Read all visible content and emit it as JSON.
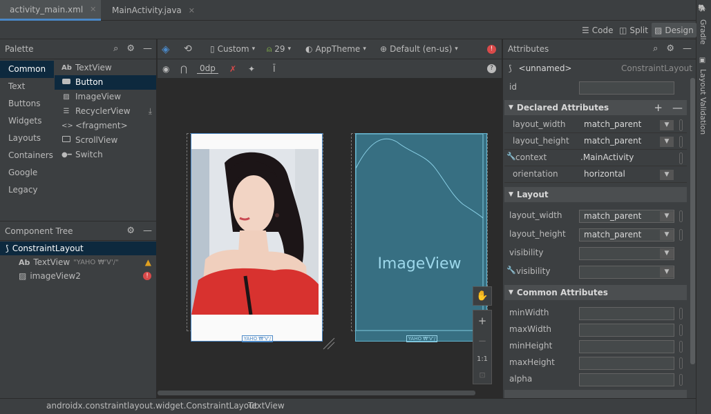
{
  "tabs": [
    {
      "label": "activity_main.xml",
      "active": true
    },
    {
      "label": "MainActivity.java",
      "active": false
    }
  ],
  "right_strip": {
    "gradle": "Gradle",
    "layout_validation": "Layout Validation"
  },
  "view_modes": {
    "code": "Code",
    "split": "Split",
    "design": "Design"
  },
  "palette": {
    "title": "Palette",
    "categories": [
      "Common",
      "Text",
      "Buttons",
      "Widgets",
      "Layouts",
      "Containers",
      "Google",
      "Legacy"
    ],
    "items": [
      {
        "icon": "Ab",
        "label": "TextView"
      },
      {
        "icon": "btn",
        "label": "Button"
      },
      {
        "icon": "img",
        "label": "ImageView"
      },
      {
        "icon": "list",
        "label": "RecyclerView"
      },
      {
        "icon": "<>",
        "label": "<fragment>"
      },
      {
        "icon": "scroll",
        "label": "ScrollView"
      },
      {
        "icon": "sw",
        "label": "Switch"
      }
    ]
  },
  "component_tree": {
    "title": "Component Tree",
    "root": "ConstraintLayout",
    "children": [
      {
        "icon": "Ab",
        "label": "TextView",
        "detail": "\"YAHO ₩'V'/\"",
        "status": "warning"
      },
      {
        "icon": "img",
        "label": "imageView2",
        "detail": "",
        "status": "error"
      }
    ]
  },
  "canvas_toolbar": {
    "device": "Custom",
    "api": "29",
    "theme": "AppTheme",
    "locale": "Default (en-us)",
    "margin": "0dp"
  },
  "canvas": {
    "design_caption": "YAHO ₩'V'/",
    "blueprint_label": "ImageView",
    "blueprint_caption": "YAHO ₩'V'/",
    "zoom_fit": "1:1"
  },
  "attributes": {
    "title": "Attributes",
    "component": "<unnamed>",
    "component_type": "ConstraintLayout",
    "id_label": "id",
    "id_value": "",
    "declared": {
      "title": "Declared Attributes",
      "rows": [
        {
          "label": "layout_width",
          "value": "match_parent"
        },
        {
          "label": "layout_height",
          "value": "match_parent"
        },
        {
          "label": "context",
          "value": ".MainActivity"
        },
        {
          "label": "orientation",
          "value": "horizontal"
        }
      ]
    },
    "layout": {
      "title": "Layout",
      "rows": [
        {
          "label": "layout_width",
          "value": "match_parent"
        },
        {
          "label": "layout_height",
          "value": "match_parent"
        },
        {
          "label": "visibility",
          "value": ""
        },
        {
          "label": "visibility",
          "value": ""
        }
      ]
    },
    "common": {
      "title": "Common Attributes",
      "rows": [
        {
          "label": "minWidth",
          "value": ""
        },
        {
          "label": "maxWidth",
          "value": ""
        },
        {
          "label": "minHeight",
          "value": ""
        },
        {
          "label": "maxHeight",
          "value": ""
        },
        {
          "label": "alpha",
          "value": ""
        }
      ]
    }
  },
  "status_bar": {
    "path": "androidx.constraintlayout.widget.ConstraintLayout",
    "leaf": "TextView"
  },
  "colors": {
    "accent": "#4a88c7",
    "selection": "#0d293e",
    "blueprint": "#376f82",
    "warning": "#e0a020",
    "error": "#d94a4a"
  }
}
